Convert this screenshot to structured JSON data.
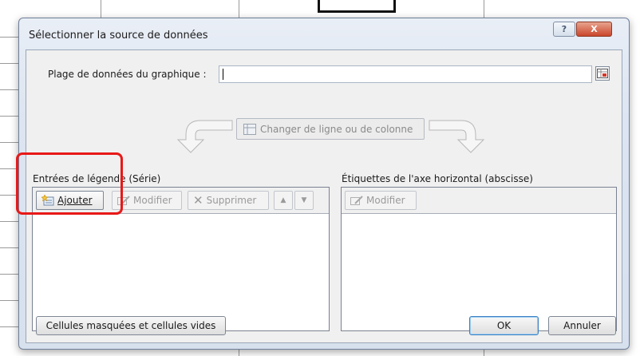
{
  "dialog": {
    "title": "Sélectionner la source de données",
    "help_label": "?",
    "close_label": "X"
  },
  "range": {
    "label": "Plage de données du graphique :",
    "value": ""
  },
  "switch_button": {
    "label": "Changer de ligne ou de colonne",
    "icon": "switch-row-column-icon"
  },
  "legend_panel": {
    "title": "Entrées de légende (Série)",
    "toolbar": {
      "add": "Ajouter",
      "edit": "Modifier",
      "delete": "Supprimer",
      "move_up_icon": "arrow-up-icon",
      "move_down_icon": "arrow-down-icon"
    },
    "items": []
  },
  "axis_panel": {
    "title": "Étiquettes de l'axe horizontal (abscisse)",
    "toolbar": {
      "edit": "Modifier"
    },
    "items": []
  },
  "footer": {
    "hidden_cells": "Cellules masquées et cellules vides",
    "ok": "OK",
    "cancel": "Annuler"
  },
  "colors": {
    "highlight": "#e81818",
    "close_button": "#c9462b",
    "title_bar": "#dce5f1"
  }
}
